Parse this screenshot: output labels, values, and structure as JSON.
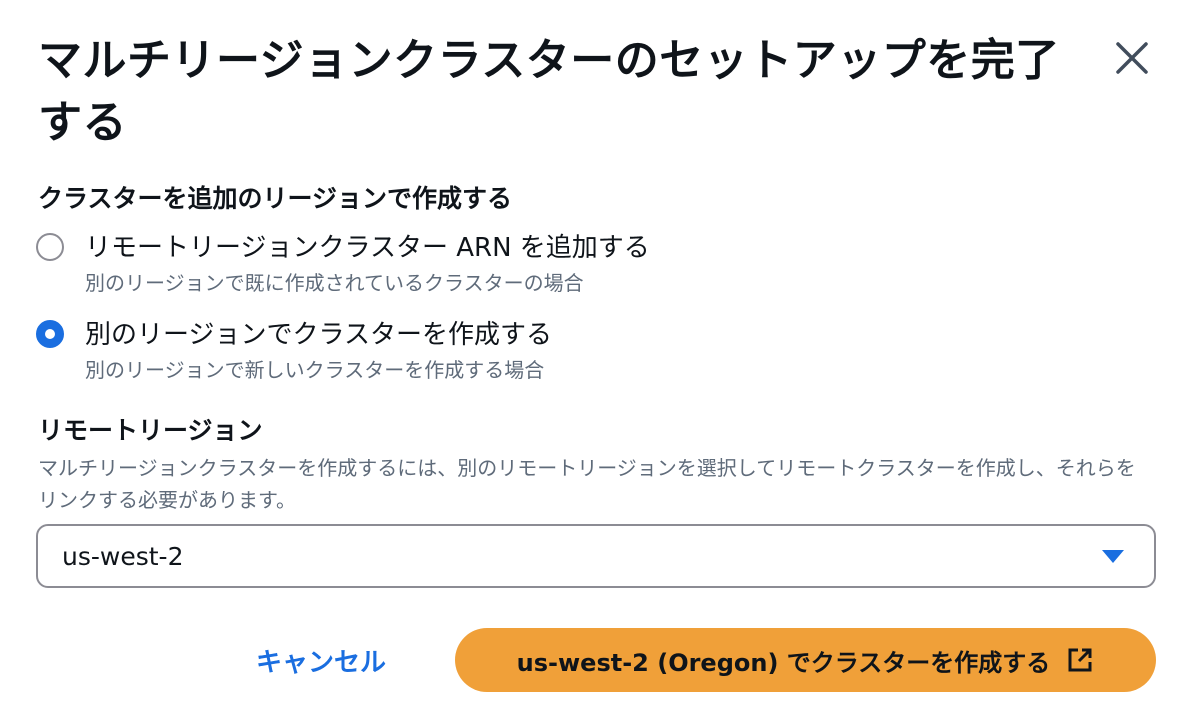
{
  "dialog": {
    "title": "マルチリージョンクラスターのセットアップを完了する",
    "close_icon": "close-icon"
  },
  "cluster_creation": {
    "label": "クラスターを追加のリージョンで作成する",
    "options": [
      {
        "label": "リモートリージョンクラスター ARN を追加する",
        "description": "別のリージョンで既に作成されているクラスターの場合",
        "selected": false
      },
      {
        "label": "別のリージョンでクラスターを作成する",
        "description": "別のリージョンで新しいクラスターを作成する場合",
        "selected": true
      }
    ]
  },
  "remote_region": {
    "label": "リモートリージョン",
    "description": "マルチリージョンクラスターを作成するには、別のリモートリージョンを選択してリモートクラスターを作成し、それらをリンクする必要があります。",
    "selected_value": "us-west-2",
    "caret_icon": "caret-down-icon"
  },
  "footer": {
    "cancel_label": "キャンセル",
    "create_label": "us-west-2 (Oregon) でクラスターを作成する",
    "create_icon": "external-link-icon"
  },
  "colors": {
    "accent": "#1a6ee0",
    "primary_button": "#f0a039",
    "secondary_text": "#5f6b7a"
  }
}
